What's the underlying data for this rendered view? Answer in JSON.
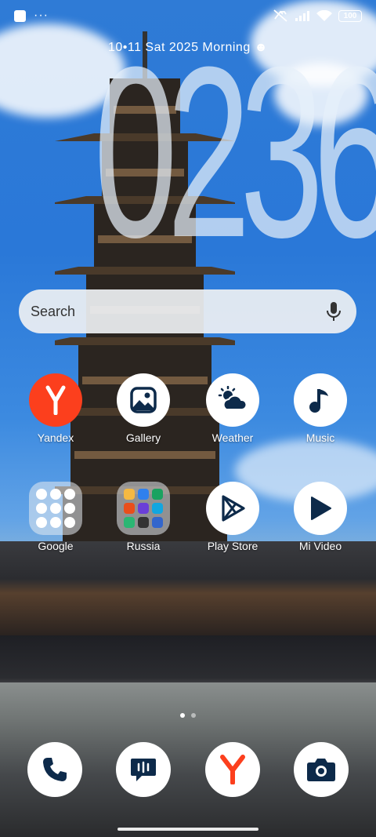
{
  "status_bar": {
    "battery": "100",
    "icons": [
      "notification-square-icon",
      "more-dots-icon",
      "mute-icon",
      "signal-icon",
      "wifi-icon",
      "battery-icon"
    ],
    "dots": "···"
  },
  "lockscreen": {
    "date_line": "10•11 Sat  2025  Morning ☻",
    "clock": "0236"
  },
  "search": {
    "placeholder": "Search"
  },
  "apps": [
    {
      "label": "Yandex"
    },
    {
      "label": "Gallery"
    },
    {
      "label": "Weather"
    },
    {
      "label": "Music"
    },
    {
      "label": "Google"
    },
    {
      "label": "Russia"
    },
    {
      "label": "Play Store"
    },
    {
      "label": "Mi Video"
    }
  ],
  "colors": {
    "yandex_red": "#fc3f1d",
    "icon_navy": "#0d2a4a",
    "folder_bg": "#e6ebf0"
  },
  "dock": [
    "phone-icon",
    "messages-icon",
    "yandex-browser-icon",
    "camera-icon"
  ],
  "page_indicator": {
    "count": 2,
    "active": 0
  }
}
